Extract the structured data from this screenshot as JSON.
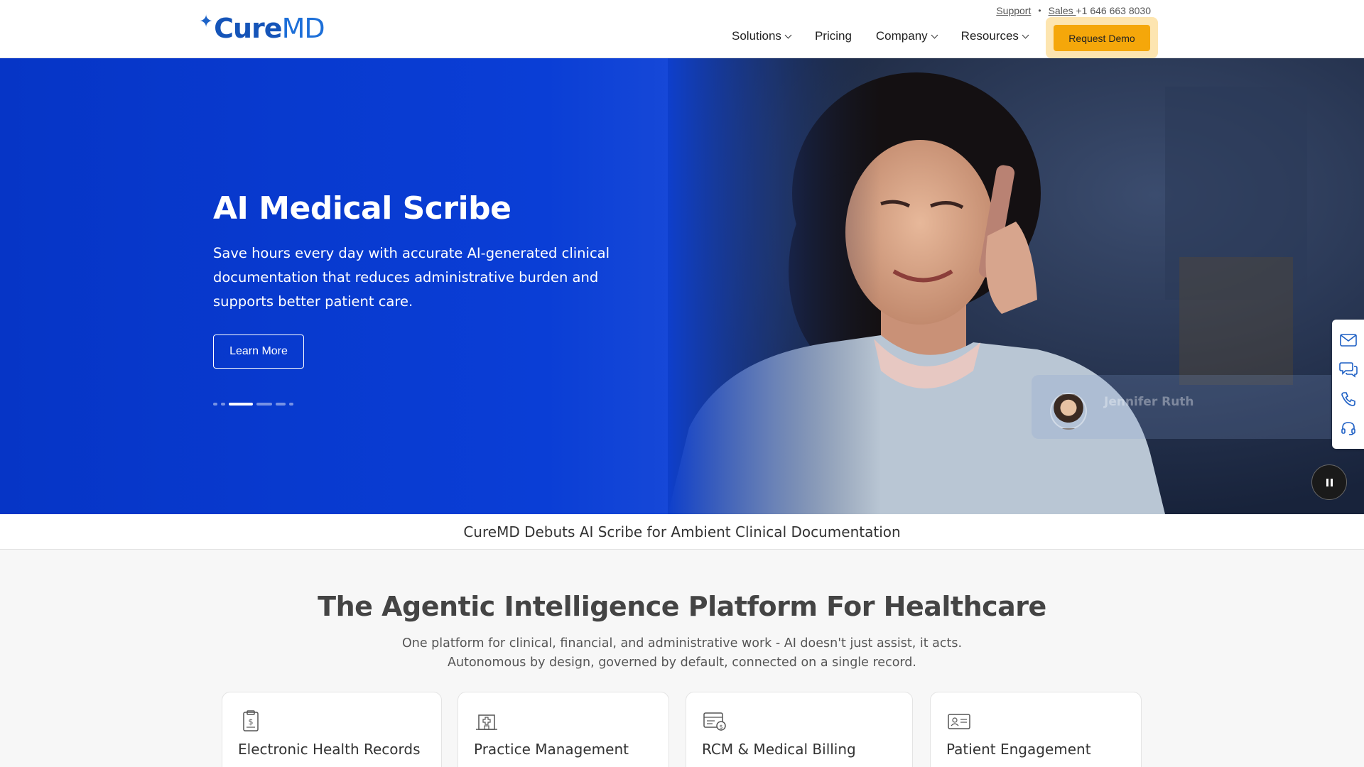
{
  "header": {
    "logo_spark": "✦",
    "logo_cure": "Cure",
    "logo_md": "MD",
    "support_label": "Support",
    "dot": "•",
    "sales_label": "Sales ",
    "sales_phone": "+1 646 663 8030",
    "nav": [
      {
        "label": "Solutions",
        "has_dropdown": true
      },
      {
        "label": "Pricing",
        "has_dropdown": false
      },
      {
        "label": "Company",
        "has_dropdown": true
      },
      {
        "label": "Resources",
        "has_dropdown": true
      }
    ],
    "cta_label": "Request Demo"
  },
  "hero": {
    "title": "AI Medical Scribe",
    "body": "Save hours every day with accurate AI-generated clinical documentation that reduces administrative burden and supports better patient care.",
    "button_label": "Learn More",
    "slide_count": 6,
    "active_slide": 2,
    "testimonial": {
      "name": "Jennifer Ruth"
    }
  },
  "side_rail": {
    "icons": [
      "mail-icon",
      "chat-icon",
      "phone-icon",
      "headset-icon"
    ]
  },
  "news": {
    "headline": "CureMD Debuts AI Scribe for Ambient Clinical Documentation"
  },
  "platform": {
    "title": "The Agentic Intelligence Platform For Healthcare",
    "subtitle_line1": "One platform for clinical, financial, and administrative work - AI doesn't just assist, it acts.",
    "subtitle_line2": "Autonomous by design, governed by default, connected on a single record.",
    "cards": [
      {
        "title": "Electronic Health Records",
        "icon": "clipboard-dollar-icon"
      },
      {
        "title": "Practice Management",
        "icon": "medical-building-icon"
      },
      {
        "title": "RCM & Medical Billing",
        "icon": "billing-invoice-icon"
      },
      {
        "title": "Patient Engagement",
        "icon": "patient-id-card-icon"
      }
    ]
  },
  "colors": {
    "brand_blue": "#1554b8",
    "hero_blue": "#0635c6",
    "cta_orange": "#f5a70a"
  }
}
